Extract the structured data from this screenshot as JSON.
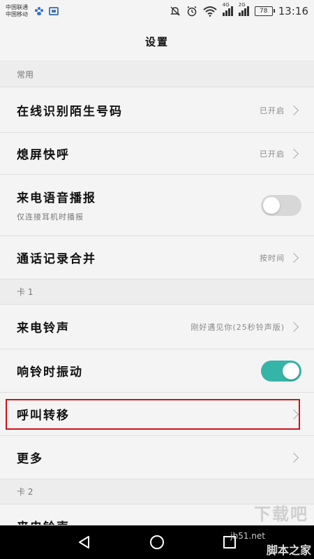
{
  "status_bar": {
    "carrier1": "中国联通",
    "carrier2": "中国移动",
    "net1": "4G",
    "net2": "2G",
    "battery": "78",
    "time": "13:16"
  },
  "header": {
    "title": "设置"
  },
  "sections": {
    "common": "常用",
    "card1": "卡 1",
    "card2": "卡 2"
  },
  "rows": {
    "identify": {
      "label": "在线识别陌生号码",
      "value": "已开启"
    },
    "screen_off": {
      "label": "熄屏快呼",
      "value": "已开启"
    },
    "voice_report": {
      "label": "来电语音播报",
      "sub": "仅连接耳机时播报",
      "toggle": "off"
    },
    "call_log": {
      "label": "通话记录合并",
      "value": "按时间"
    },
    "ringtone": {
      "label": "来电铃声",
      "value": "刚好遇见你(25秒铃声版)"
    },
    "vibrate": {
      "label": "响铃时振动",
      "toggle": "on"
    },
    "forward": {
      "label": "呼叫转移"
    },
    "more": {
      "label": "更多"
    },
    "ringtone2": {
      "label": "来电铃声"
    }
  },
  "colors": {
    "accent": "#35b4a8",
    "highlight": "#d2101a"
  },
  "watermark": {
    "logo": "下载吧",
    "url": "jb51.net",
    "site": "脚本之家"
  }
}
